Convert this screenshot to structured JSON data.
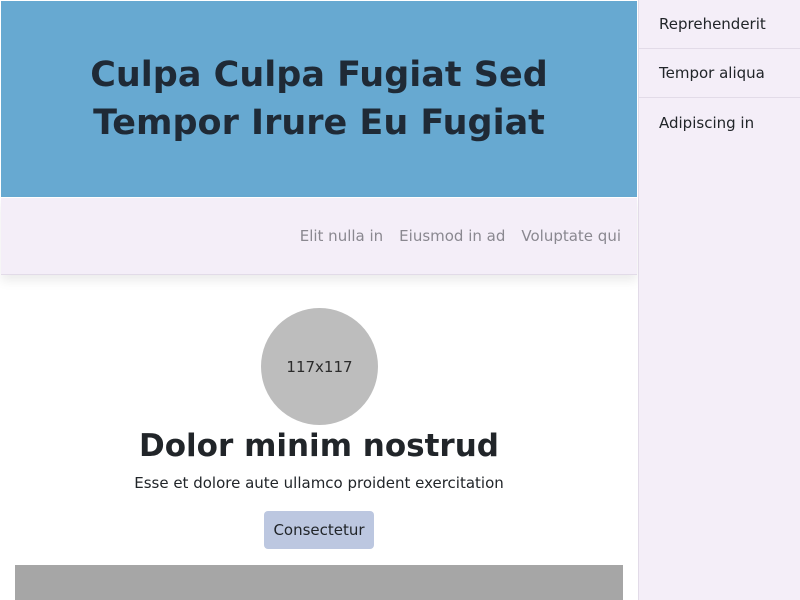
{
  "hero": {
    "title": "Culpa Culpa Fugiat Sed Tempor Irure Eu Fugiat"
  },
  "subnav": {
    "links": [
      "Elit nulla in",
      "Eiusmod in ad",
      "Voluptate qui"
    ]
  },
  "profile": {
    "avatar_label": "117x117",
    "heading": "Dolor minim nostrud",
    "description": "Esse et dolore aute ullamco proident exercitation",
    "button_label": "Consectetur"
  },
  "sidebar": {
    "items": [
      {
        "label": "Reprehenderit"
      },
      {
        "label": "Tempor aliqua"
      },
      {
        "label": "Adipiscing in"
      }
    ]
  },
  "colors": {
    "hero_bg": "#67a9d1",
    "nav_bg": "#f4eef8",
    "button_bg": "#bcc7e0",
    "avatar_bg": "#bdbdbd",
    "placeholder_block": "#a6a6a6"
  }
}
